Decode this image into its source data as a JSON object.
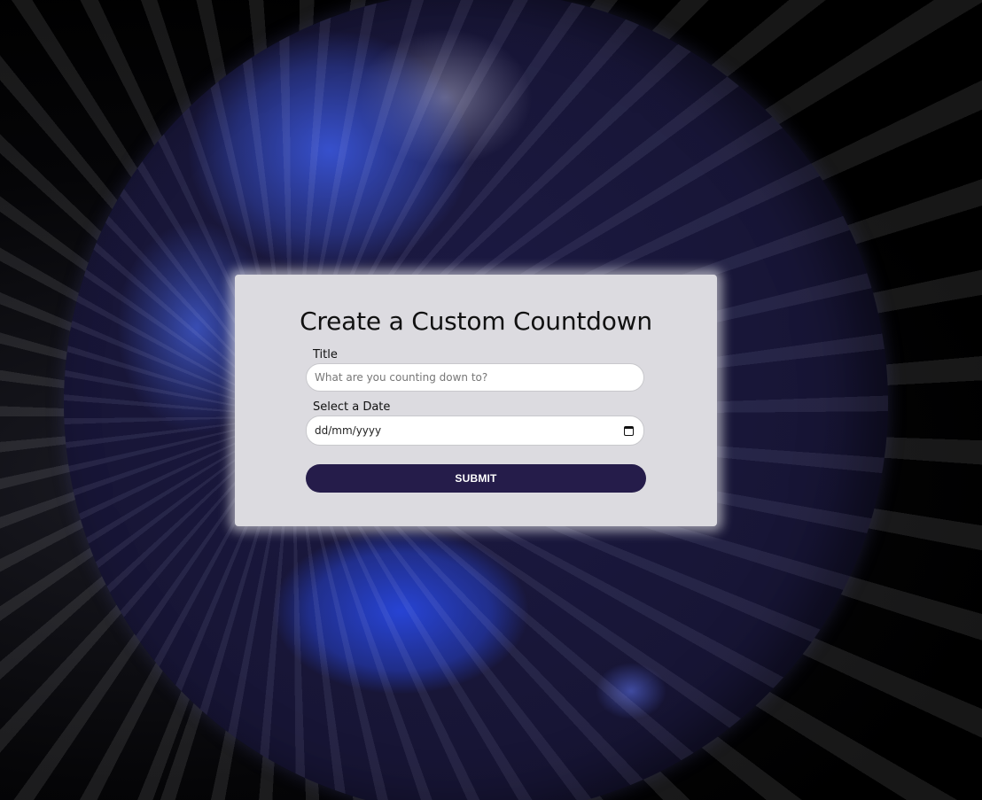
{
  "form": {
    "title": "Create a Custom Countdown",
    "title_label": "Title",
    "title_placeholder": "What are you counting down to?",
    "date_label": "Select a Date",
    "date_placeholder": "dd/mm/yyyy",
    "submit_label": "SUBMIT"
  },
  "colors": {
    "button": "#251c4a",
    "card": "#dcdbe0",
    "globe": "#171535"
  },
  "icons": {
    "date_picker": "calendar-icon"
  }
}
